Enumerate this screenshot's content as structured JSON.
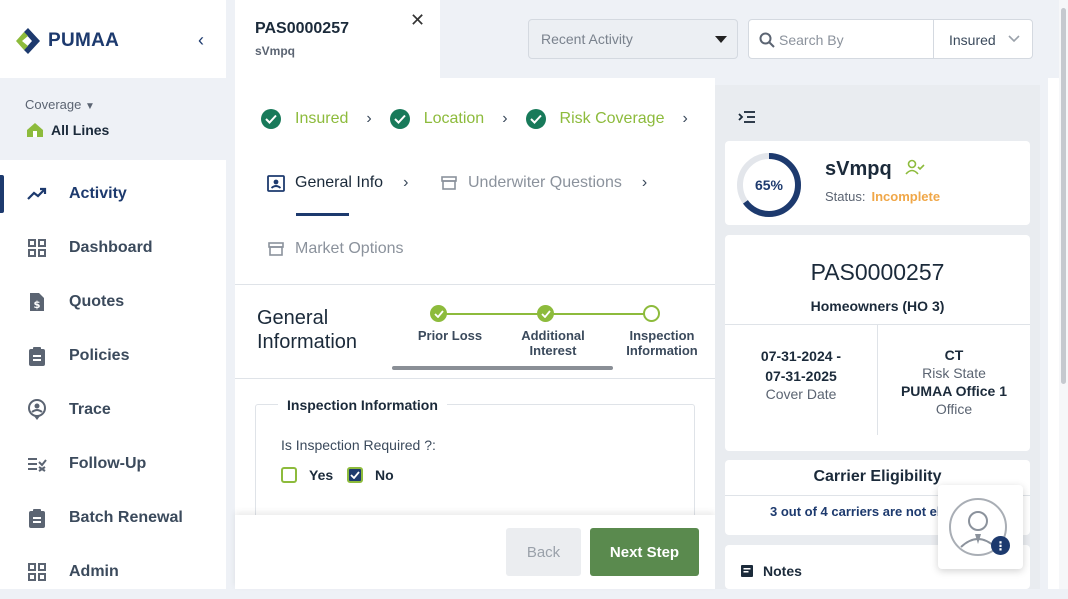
{
  "brand": {
    "name": "PUMAA"
  },
  "coverage": {
    "label": "Coverage",
    "value": "All Lines"
  },
  "nav": [
    {
      "label": "Activity",
      "icon": "trend-icon",
      "active": true
    },
    {
      "label": "Dashboard",
      "icon": "grid-icon"
    },
    {
      "label": "Quotes",
      "icon": "dollar-doc-icon"
    },
    {
      "label": "Policies",
      "icon": "clipboard-icon"
    },
    {
      "label": "Trace",
      "icon": "location-person-icon"
    },
    {
      "label": "Follow-Up",
      "icon": "list-check-icon"
    },
    {
      "label": "Batch Renewal",
      "icon": "clipboard-icon"
    },
    {
      "label": "Admin",
      "icon": "grid-icon"
    }
  ],
  "tab": {
    "title": "PAS0000257",
    "subtitle": "sVmpq"
  },
  "header": {
    "recent_activity": "Recent Activity",
    "search_placeholder": "Search By",
    "search_type": "Insured"
  },
  "steps": [
    "Insured",
    "Location",
    "Risk Coverage"
  ],
  "subtabs": [
    "General Info",
    "Underwiter Questions",
    "Market Options"
  ],
  "section": {
    "title_line1": "General",
    "title_line2": "Information"
  },
  "progress": [
    {
      "label_line1": "Prior Loss",
      "label_line2": "",
      "done": true
    },
    {
      "label_line1": "Additional",
      "label_line2": "Interest",
      "done": true
    },
    {
      "label_line1": "Inspection",
      "label_line2": "Information",
      "done": false
    }
  ],
  "inspection": {
    "legend": "Inspection Information",
    "question": "Is Inspection Required ?:",
    "yes_label": "Yes",
    "no_label": "No",
    "yes_checked": false,
    "no_checked": true
  },
  "footer": {
    "back": "Back",
    "next": "Next Step"
  },
  "summary": {
    "percent_text": "65%",
    "percent": 0.65,
    "insured_name": "sVmpq",
    "status_label": "Status:",
    "status_value": "Incomplete",
    "policy_number": "PAS0000257",
    "policy_type": "Homeowners (HO 3)",
    "cover_start": "07-31-2024 -",
    "cover_end": "07-31-2025",
    "cover_label": "Cover Date",
    "state": "CT",
    "state_label": "Risk State",
    "office": "PUMAA Office 1",
    "office_label": "Office",
    "carrier_title": "Carrier Eligibility",
    "carrier_text": "3 out of 4 carriers are not eligible",
    "notes_label": "Notes"
  },
  "colors": {
    "primary": "#1d3a6e",
    "success": "#8dbb3c",
    "check": "#187a5a",
    "next_button": "#5a8a4e",
    "status": "#f0a748"
  }
}
